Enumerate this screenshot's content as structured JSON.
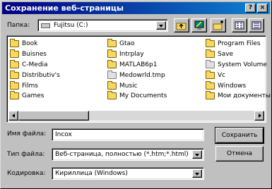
{
  "window": {
    "title": "Сохранение веб-страницы",
    "help_glyph": "?",
    "close_glyph": "×"
  },
  "location": {
    "label": "Папка:",
    "value": "Fujitsu (C:)"
  },
  "toolbar": {
    "icons": [
      "up-folder-icon",
      "desktop-icon",
      "new-folder-icon",
      "list-view-icon",
      "details-view-icon"
    ]
  },
  "files": {
    "columns": [
      [
        "Book",
        "Buisnes",
        "C-Media",
        "Distributiv's",
        "Films",
        "Games"
      ],
      [
        "Gtao",
        "Intrplay",
        "MATLAB6p1",
        "Medowrld.tmp",
        "Music",
        "My Documents"
      ],
      [
        "Program Files",
        "Save",
        "System Volume",
        "Vc",
        "Windows",
        "Мои документы"
      ]
    ]
  },
  "form": {
    "filename_label": "Имя файла:",
    "filename_value": "Incox",
    "filetype_label": "Тип файла:",
    "filetype_value": "Веб-страница, полностью (*.htm;*.html)",
    "encoding_label": "Кодировка:",
    "encoding_value": "Кириллица (Windows)"
  },
  "buttons": {
    "save": "Сохранить",
    "cancel": "Отмена"
  }
}
